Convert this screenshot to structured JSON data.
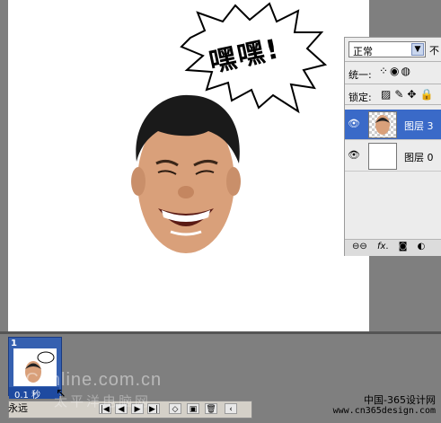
{
  "canvas": {
    "speech_bubble_text": "嘿嘿!"
  },
  "layers_panel": {
    "blend_mode": "正常",
    "opacity_label": "不",
    "unify_label": "统一:",
    "lock_label": "锁定:",
    "layers": [
      {
        "name": "图层 3",
        "selected": true,
        "visible": true
      },
      {
        "name": "图层 0",
        "selected": false,
        "visible": true
      }
    ],
    "bottom_icons": [
      "link-icon",
      "fx-icon",
      "mask-icon",
      "adjustment-icon"
    ]
  },
  "animation": {
    "frame_number": "1",
    "frame_delay": "0.1 秒",
    "loop": "永远"
  },
  "watermarks": {
    "left_1": "PConline.com.cn",
    "left_2": "太平洋电脑网",
    "right_1": "中国-365设计网",
    "right_2": "www.cn365design.com"
  }
}
